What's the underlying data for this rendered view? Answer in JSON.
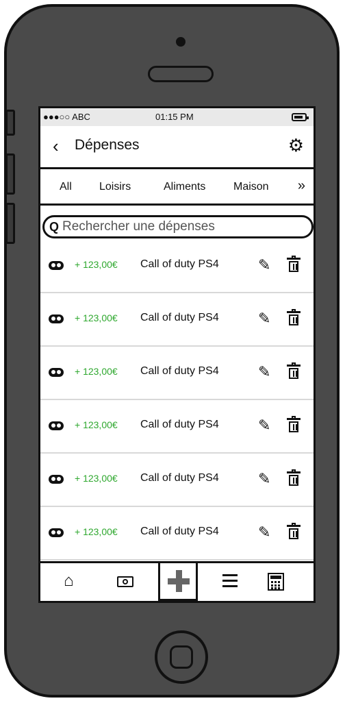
{
  "status_bar": {
    "signal": "●●●○○ ABC",
    "time": "01:15 PM"
  },
  "nav": {
    "back_icon": "chevron-left-icon",
    "back_glyph": "‹",
    "title": "Dépenses",
    "settings_icon": "gear-icon",
    "settings_glyph": "⚙"
  },
  "tabs": [
    {
      "label": "All"
    },
    {
      "label": "Loisirs"
    },
    {
      "label": "Aliments"
    },
    {
      "label": "Maison"
    }
  ],
  "tabs_more_glyph": "»",
  "search": {
    "placeholder": "Rechercher une dépenses",
    "value": "",
    "icon": "search-icon",
    "glyph": "Q"
  },
  "expenses": [
    {
      "amount": "+ 123,00€",
      "label": "Call of duty PS4"
    },
    {
      "amount": "+ 123,00€",
      "label": "Call of duty PS4"
    },
    {
      "amount": "+ 123,00€",
      "label": "Call of duty PS4"
    },
    {
      "amount": "+ 123,00€",
      "label": "Call of duty PS4"
    },
    {
      "amount": "+ 123,00€",
      "label": "Call of duty PS4"
    },
    {
      "amount": "+ 123,00€",
      "label": "Call of duty PS4"
    }
  ],
  "row_icons": {
    "category": "gamepad-icon",
    "edit": "pencil-icon",
    "delete": "trash-icon",
    "edit_glyph": "✎"
  },
  "tabbar": {
    "home": "home-icon",
    "home_glyph": "⌂",
    "money": "money-icon",
    "add": "plus-icon",
    "list": "list-icon",
    "calc": "calculator-icon"
  },
  "colors": {
    "amount_positive": "#2fa82f",
    "phone_body": "#4a4a4a",
    "status_bar": "#e9e9e9"
  }
}
